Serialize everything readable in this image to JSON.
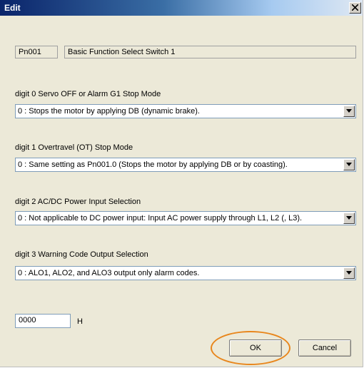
{
  "window": {
    "title": "Edit",
    "close_glyph": "X"
  },
  "parameter": {
    "number": "Pn001",
    "name": "Basic Function Select Switch 1"
  },
  "digits": [
    {
      "label": "digit 0  Servo OFF or Alarm G1 Stop Mode",
      "selected": "0 : Stops the motor by applying DB (dynamic brake)."
    },
    {
      "label": "digit 1  Overtravel (OT) Stop Mode",
      "selected": "0 : Same setting as Pn001.0 (Stops the motor by applying DB or by coasting)."
    },
    {
      "label": "digit 2  AC/DC Power Input Selection",
      "selected": "0 : Not applicable to DC power input: Input AC power supply through L1, L2 (, L3)."
    },
    {
      "label": "digit 3  Warning Code Output Selection",
      "selected": "0 : ALO1, ALO2, and ALO3 output only alarm codes."
    }
  ],
  "value": {
    "text": "0000",
    "unit": "H"
  },
  "buttons": {
    "ok": "OK",
    "cancel": "Cancel"
  },
  "colors": {
    "highlight": "#e8861c",
    "title_start": "#0a246a",
    "dialog_bg": "#ece9d8"
  },
  "icons": {
    "close": "close-icon",
    "dropdown": "chevron-down-icon"
  }
}
